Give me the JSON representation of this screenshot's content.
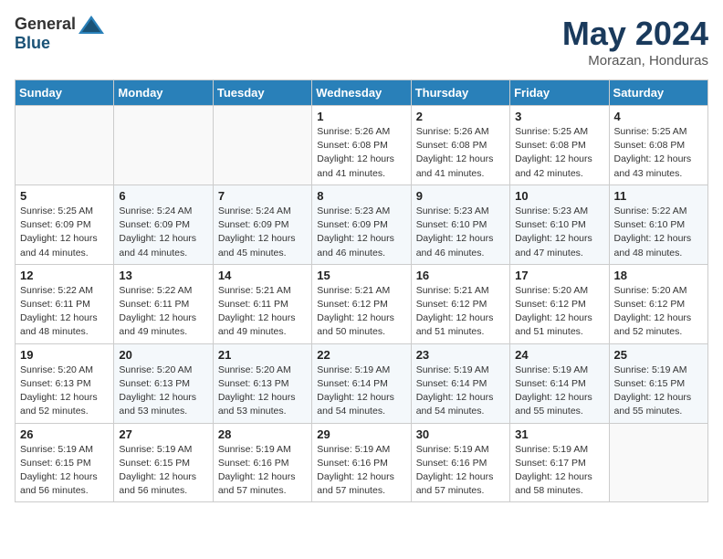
{
  "header": {
    "logo_general": "General",
    "logo_blue": "Blue",
    "month_title": "May 2024",
    "location": "Morazan, Honduras"
  },
  "days_of_week": [
    "Sunday",
    "Monday",
    "Tuesday",
    "Wednesday",
    "Thursday",
    "Friday",
    "Saturday"
  ],
  "weeks": [
    [
      {
        "day": "",
        "info": ""
      },
      {
        "day": "",
        "info": ""
      },
      {
        "day": "",
        "info": ""
      },
      {
        "day": "1",
        "info": "Sunrise: 5:26 AM\nSunset: 6:08 PM\nDaylight: 12 hours\nand 41 minutes."
      },
      {
        "day": "2",
        "info": "Sunrise: 5:26 AM\nSunset: 6:08 PM\nDaylight: 12 hours\nand 41 minutes."
      },
      {
        "day": "3",
        "info": "Sunrise: 5:25 AM\nSunset: 6:08 PM\nDaylight: 12 hours\nand 42 minutes."
      },
      {
        "day": "4",
        "info": "Sunrise: 5:25 AM\nSunset: 6:08 PM\nDaylight: 12 hours\nand 43 minutes."
      }
    ],
    [
      {
        "day": "5",
        "info": "Sunrise: 5:25 AM\nSunset: 6:09 PM\nDaylight: 12 hours\nand 44 minutes."
      },
      {
        "day": "6",
        "info": "Sunrise: 5:24 AM\nSunset: 6:09 PM\nDaylight: 12 hours\nand 44 minutes."
      },
      {
        "day": "7",
        "info": "Sunrise: 5:24 AM\nSunset: 6:09 PM\nDaylight: 12 hours\nand 45 minutes."
      },
      {
        "day": "8",
        "info": "Sunrise: 5:23 AM\nSunset: 6:09 PM\nDaylight: 12 hours\nand 46 minutes."
      },
      {
        "day": "9",
        "info": "Sunrise: 5:23 AM\nSunset: 6:10 PM\nDaylight: 12 hours\nand 46 minutes."
      },
      {
        "day": "10",
        "info": "Sunrise: 5:23 AM\nSunset: 6:10 PM\nDaylight: 12 hours\nand 47 minutes."
      },
      {
        "day": "11",
        "info": "Sunrise: 5:22 AM\nSunset: 6:10 PM\nDaylight: 12 hours\nand 48 minutes."
      }
    ],
    [
      {
        "day": "12",
        "info": "Sunrise: 5:22 AM\nSunset: 6:11 PM\nDaylight: 12 hours\nand 48 minutes."
      },
      {
        "day": "13",
        "info": "Sunrise: 5:22 AM\nSunset: 6:11 PM\nDaylight: 12 hours\nand 49 minutes."
      },
      {
        "day": "14",
        "info": "Sunrise: 5:21 AM\nSunset: 6:11 PM\nDaylight: 12 hours\nand 49 minutes."
      },
      {
        "day": "15",
        "info": "Sunrise: 5:21 AM\nSunset: 6:12 PM\nDaylight: 12 hours\nand 50 minutes."
      },
      {
        "day": "16",
        "info": "Sunrise: 5:21 AM\nSunset: 6:12 PM\nDaylight: 12 hours\nand 51 minutes."
      },
      {
        "day": "17",
        "info": "Sunrise: 5:20 AM\nSunset: 6:12 PM\nDaylight: 12 hours\nand 51 minutes."
      },
      {
        "day": "18",
        "info": "Sunrise: 5:20 AM\nSunset: 6:12 PM\nDaylight: 12 hours\nand 52 minutes."
      }
    ],
    [
      {
        "day": "19",
        "info": "Sunrise: 5:20 AM\nSunset: 6:13 PM\nDaylight: 12 hours\nand 52 minutes."
      },
      {
        "day": "20",
        "info": "Sunrise: 5:20 AM\nSunset: 6:13 PM\nDaylight: 12 hours\nand 53 minutes."
      },
      {
        "day": "21",
        "info": "Sunrise: 5:20 AM\nSunset: 6:13 PM\nDaylight: 12 hours\nand 53 minutes."
      },
      {
        "day": "22",
        "info": "Sunrise: 5:19 AM\nSunset: 6:14 PM\nDaylight: 12 hours\nand 54 minutes."
      },
      {
        "day": "23",
        "info": "Sunrise: 5:19 AM\nSunset: 6:14 PM\nDaylight: 12 hours\nand 54 minutes."
      },
      {
        "day": "24",
        "info": "Sunrise: 5:19 AM\nSunset: 6:14 PM\nDaylight: 12 hours\nand 55 minutes."
      },
      {
        "day": "25",
        "info": "Sunrise: 5:19 AM\nSunset: 6:15 PM\nDaylight: 12 hours\nand 55 minutes."
      }
    ],
    [
      {
        "day": "26",
        "info": "Sunrise: 5:19 AM\nSunset: 6:15 PM\nDaylight: 12 hours\nand 56 minutes."
      },
      {
        "day": "27",
        "info": "Sunrise: 5:19 AM\nSunset: 6:15 PM\nDaylight: 12 hours\nand 56 minutes."
      },
      {
        "day": "28",
        "info": "Sunrise: 5:19 AM\nSunset: 6:16 PM\nDaylight: 12 hours\nand 57 minutes."
      },
      {
        "day": "29",
        "info": "Sunrise: 5:19 AM\nSunset: 6:16 PM\nDaylight: 12 hours\nand 57 minutes."
      },
      {
        "day": "30",
        "info": "Sunrise: 5:19 AM\nSunset: 6:16 PM\nDaylight: 12 hours\nand 57 minutes."
      },
      {
        "day": "31",
        "info": "Sunrise: 5:19 AM\nSunset: 6:17 PM\nDaylight: 12 hours\nand 58 minutes."
      },
      {
        "day": "",
        "info": ""
      }
    ]
  ]
}
